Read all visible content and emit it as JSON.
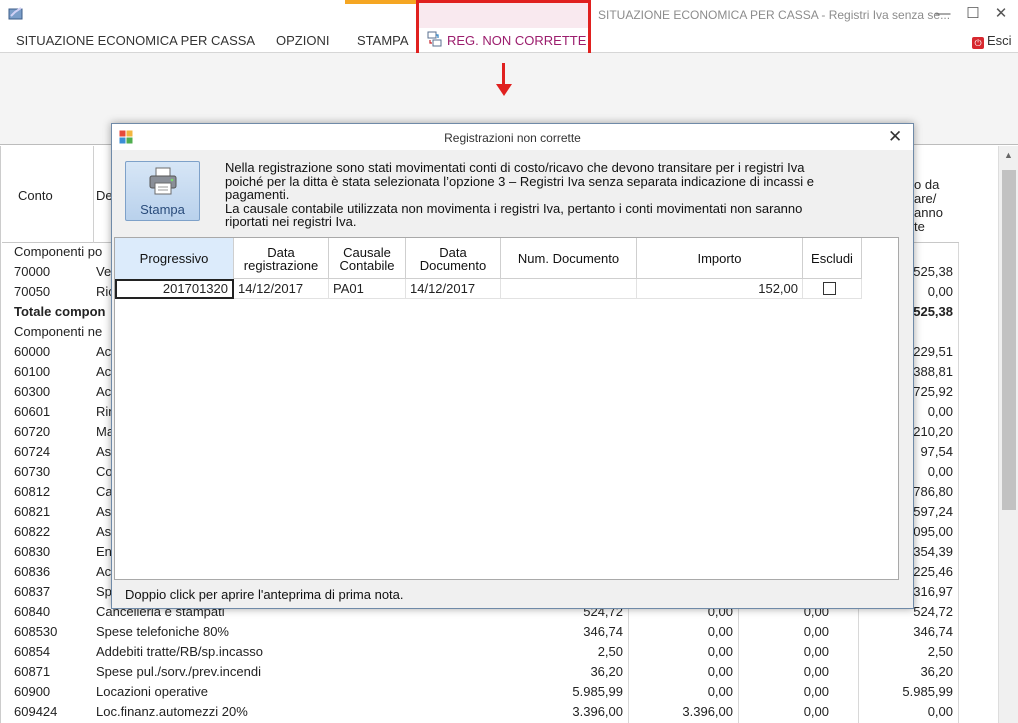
{
  "window": {
    "title": "SITUAZIONE ECONOMICA PER CASSA - Registri Iva senza se...",
    "minimize_glyph": "—",
    "maximize_glyph": "☐",
    "close_glyph": "✕"
  },
  "menu": {
    "items": [
      {
        "label": "SITUAZIONE ECONOMICA PER CASSA"
      },
      {
        "label": "OPZIONI"
      },
      {
        "label": "STAMPA"
      },
      {
        "label": "REG. NON CORRETTE"
      }
    ],
    "exit_label": "Esci"
  },
  "report": {
    "header": {
      "conto": "Conto",
      "descrizione": "De",
      "last_col_lines": [
        "o da",
        "are/",
        "anno",
        "te"
      ]
    },
    "rows": [
      {
        "conto": "Componenti po",
        "desc": "",
        "v1": "",
        "v2": "",
        "v3": "",
        "v4": "",
        "bold": false
      },
      {
        "conto": "70000",
        "desc": "Ve",
        "v1": "",
        "v2": "",
        "v3": "",
        "v4": "525,38",
        "bold": false
      },
      {
        "conto": "70050",
        "desc": "Ric",
        "v1": "",
        "v2": "",
        "v3": "",
        "v4": "0,00",
        "bold": false
      },
      {
        "conto": "Totale compon",
        "desc": "",
        "v1": "",
        "v2": "",
        "v3": "",
        "v4": "525,38",
        "bold": true
      },
      {
        "conto": "Componenti ne",
        "desc": "",
        "v1": "",
        "v2": "",
        "v3": "",
        "v4": "",
        "bold": false
      },
      {
        "conto": "60000",
        "desc": "Ac",
        "v1": "",
        "v2": "",
        "v3": "",
        "v4": "229,51",
        "bold": false
      },
      {
        "conto": "60100",
        "desc": "Ac",
        "v1": "",
        "v2": "",
        "v3": "",
        "v4": "388,81",
        "bold": false
      },
      {
        "conto": "60300",
        "desc": "Ac",
        "v1": "",
        "v2": "",
        "v3": "",
        "v4": "725,92",
        "bold": false
      },
      {
        "conto": "60601",
        "desc": "Rin",
        "v1": "",
        "v2": "",
        "v3": "",
        "v4": "0,00",
        "bold": false
      },
      {
        "conto": "60720",
        "desc": "Ma",
        "v1": "",
        "v2": "",
        "v3": "",
        "v4": "210,20",
        "bold": false
      },
      {
        "conto": "60724",
        "desc": "As",
        "v1": "",
        "v2": "",
        "v3": "",
        "v4": "97,54",
        "bold": false
      },
      {
        "conto": "60730",
        "desc": "Co",
        "v1": "",
        "v2": "",
        "v3": "",
        "v4": "0,00",
        "bold": false
      },
      {
        "conto": "60812",
        "desc": "Ca",
        "v1": "",
        "v2": "",
        "v3": "",
        "v4": "786,80",
        "bold": false
      },
      {
        "conto": "60821",
        "desc": "As",
        "v1": "",
        "v2": "",
        "v3": "",
        "v4": "597,24",
        "bold": false
      },
      {
        "conto": "60822",
        "desc": "As",
        "v1": "",
        "v2": "",
        "v3": "",
        "v4": "095,00",
        "bold": false
      },
      {
        "conto": "60830",
        "desc": "En",
        "v1": "",
        "v2": "",
        "v3": "",
        "v4": "354,39",
        "bold": false
      },
      {
        "conto": "60836",
        "desc": "Ac",
        "v1": "",
        "v2": "",
        "v3": "",
        "v4": "225,46",
        "bold": false
      },
      {
        "conto": "60837",
        "desc": "Sp",
        "v1": "",
        "v2": "",
        "v3": "",
        "v4": "316,97",
        "bold": false
      },
      {
        "conto": "60840",
        "desc": "Cancelleria e stampati",
        "v1": "524,72",
        "v2": "0,00",
        "v3": "0,00",
        "v4": "524,72",
        "bold": false
      },
      {
        "conto": "608530",
        "desc": "Spese telefoniche 80%",
        "v1": "346,74",
        "v2": "0,00",
        "v3": "0,00",
        "v4": "346,74",
        "bold": false
      },
      {
        "conto": "60854",
        "desc": "Addebiti tratte/RB/sp.incasso",
        "v1": "2,50",
        "v2": "0,00",
        "v3": "0,00",
        "v4": "2,50",
        "bold": false
      },
      {
        "conto": "60871",
        "desc": "Spese pul./sorv./prev.incendi",
        "v1": "36,20",
        "v2": "0,00",
        "v3": "0,00",
        "v4": "36,20",
        "bold": false
      },
      {
        "conto": "60900",
        "desc": "Locazioni operative",
        "v1": "5.985,99",
        "v2": "0,00",
        "v3": "0,00",
        "v4": "5.985,99",
        "bold": false
      },
      {
        "conto": "609424",
        "desc": "Loc.finanz.automezzi 20%",
        "v1": "3.396,00",
        "v2": "3.396,00",
        "v3": "0,00",
        "v4": "0,00",
        "bold": false
      }
    ]
  },
  "dialog": {
    "title": "Registrazioni non corrette",
    "close_glyph": "✕",
    "print_button_label": "Stampa",
    "message_lines": [
      "Nella registrazione sono stati movimentati conti di costo/ricavo che devono transitare per i registri Iva",
      "poiché per la ditta è stata selezionata l’opzione 3 – Registri Iva senza separata indicazione di incassi e",
      "pagamenti.",
      "La causale contabile utilizzata non movimenta i registri Iva, pertanto i conti movimentati non saranno",
      "riportati nei registri Iva."
    ],
    "columns": [
      {
        "label": "Progressivo"
      },
      {
        "label": "Data registrazione"
      },
      {
        "label": "Causale Contabile"
      },
      {
        "label": "Data Documento"
      },
      {
        "label": "Num. Documento"
      },
      {
        "label": "Importo"
      },
      {
        "label": "Escludi"
      }
    ],
    "rows": [
      {
        "progressivo": "201701320",
        "data_registrazione": "14/12/2017",
        "causale": "PA01",
        "data_documento": "14/12/2017",
        "num_documento": "",
        "importo": "152,00",
        "escludi": false
      }
    ],
    "footer": "Doppio click per aprire l'anteprima di prima nota."
  },
  "colors": {
    "highlight": "#e0201f",
    "active_tab_text": "#9b1d6d",
    "stampa_accent": "#f5a623",
    "selected_header": "#dcebfb"
  },
  "icons": {
    "app": "app-window-icon",
    "reg_non_corrette": "records-error-icon",
    "exit": "exit-icon",
    "dialog": "dialog-app-icon",
    "print": "printer-icon",
    "arrow": "arrow-down-icon"
  }
}
